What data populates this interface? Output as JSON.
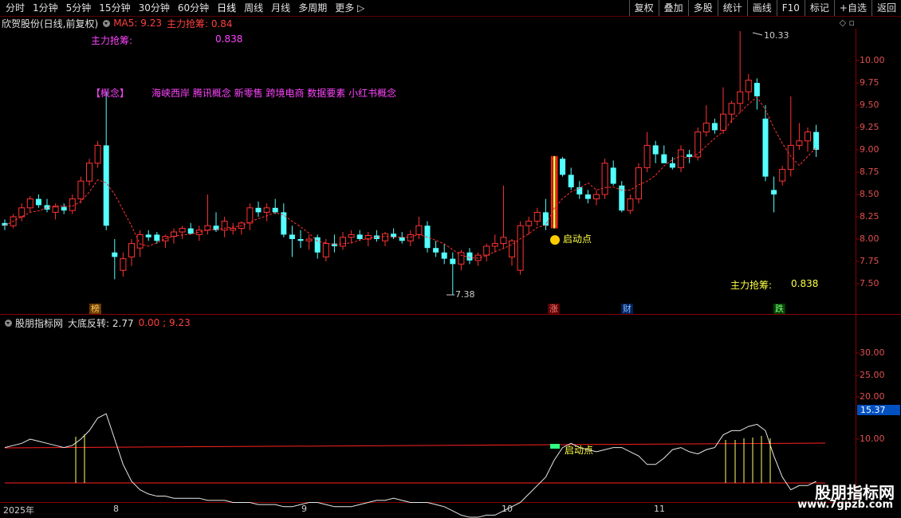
{
  "toolbar": {
    "periods": [
      "分时",
      "1分钟",
      "5分钟",
      "15分钟",
      "30分钟",
      "60分钟",
      "日线",
      "周线",
      "月线",
      "多周期",
      "更多"
    ],
    "buttons": [
      "复权",
      "叠加",
      "多股",
      "统计",
      "画线",
      "F10",
      "标记",
      "+自选",
      "返回"
    ]
  },
  "info": {
    "stock_name": "欣贺股份(日线,前复权)",
    "ma_label": "MA5: 9.23",
    "zl_label": "主力抢筹: 0.84"
  },
  "overlay": {
    "zl_title": "主力抢筹:",
    "zl_value": "0.838",
    "concept_label": "【概念】",
    "concepts": "海峡西岸 腾讯概念 新零售 跨境电商 数据要素 小红书概念",
    "qdd": "启动点",
    "zl_title2": "主力抢筹:",
    "zl_value2": "0.838",
    "high_price": "10.33",
    "low_price": "7.38"
  },
  "tags": {
    "bang": "榜",
    "zhang": "涨",
    "cai": "财",
    "die": "跌"
  },
  "sub": {
    "name": "股朋指标网",
    "name2": "大底反转: 2.77",
    "vals": "0.00 ; 9.23",
    "qdd": "启动点",
    "current": "15.37"
  },
  "axis": {
    "main": [
      "10.00",
      "9.75",
      "9.50",
      "9.25",
      "9.00",
      "8.75",
      "8.50",
      "8.25",
      "8.00",
      "7.75",
      "7.50"
    ],
    "sub": [
      "30.00",
      "25.00",
      "20.00",
      "10.00"
    ]
  },
  "dates": {
    "d0": "2025年",
    "d1": "8",
    "d2": "9",
    "d3": "10",
    "d4": "11"
  },
  "watermark": {
    "logo": "股朋指标网",
    "url": "www.7gpzb.com"
  },
  "colors": {
    "up": "#ff3232",
    "down": "#54ffff",
    "ma": "#ff3232",
    "zl": "#ff44ff",
    "yellow": "#ffff44"
  },
  "chart_data": {
    "type": "candlestick",
    "ohlc": [
      [
        8.18,
        8.22,
        8.1,
        8.15
      ],
      [
        8.15,
        8.28,
        8.12,
        8.25
      ],
      [
        8.25,
        8.4,
        8.2,
        8.35
      ],
      [
        8.35,
        8.48,
        8.3,
        8.45
      ],
      [
        8.45,
        8.5,
        8.35,
        8.38
      ],
      [
        8.38,
        8.45,
        8.3,
        8.33
      ],
      [
        8.3,
        8.4,
        8.22,
        8.36
      ],
      [
        8.36,
        8.4,
        8.28,
        8.32
      ],
      [
        8.32,
        8.5,
        8.28,
        8.45
      ],
      [
        8.45,
        8.7,
        8.4,
        8.65
      ],
      [
        8.65,
        8.9,
        8.6,
        8.85
      ],
      [
        8.85,
        9.1,
        8.8,
        9.05
      ],
      [
        9.05,
        9.65,
        8.1,
        8.15
      ],
      [
        7.85,
        8.0,
        7.55,
        7.8
      ],
      [
        7.65,
        7.85,
        7.58,
        7.78
      ],
      [
        7.8,
        8.0,
        7.7,
        7.95
      ],
      [
        7.9,
        8.1,
        7.8,
        8.05
      ],
      [
        8.05,
        8.1,
        7.98,
        8.02
      ],
      [
        8.05,
        8.08,
        7.95,
        7.98
      ],
      [
        7.98,
        8.05,
        7.9,
        8.03
      ],
      [
        8.03,
        8.12,
        7.95,
        8.08
      ],
      [
        8.08,
        8.15,
        8.0,
        8.12
      ],
      [
        8.12,
        8.18,
        8.05,
        8.06
      ],
      [
        8.05,
        8.15,
        7.98,
        8.1
      ],
      [
        8.1,
        8.5,
        8.05,
        8.15
      ],
      [
        8.15,
        8.3,
        8.08,
        8.1
      ],
      [
        8.1,
        8.25,
        8.02,
        8.2
      ],
      [
        8.1,
        8.18,
        8.05,
        8.12
      ],
      [
        8.12,
        8.2,
        8.05,
        8.18
      ],
      [
        8.18,
        8.4,
        8.1,
        8.35
      ],
      [
        8.35,
        8.42,
        8.25,
        8.3
      ],
      [
        8.3,
        8.4,
        8.2,
        8.35
      ],
      [
        8.35,
        8.45,
        8.28,
        8.3
      ],
      [
        8.3,
        8.4,
        8.02,
        8.05
      ],
      [
        8.05,
        8.15,
        7.8,
        8.0
      ],
      [
        8.0,
        8.1,
        7.9,
        7.98
      ],
      [
        7.98,
        8.05,
        7.88,
        8.0
      ],
      [
        8.02,
        8.05,
        7.78,
        7.85
      ],
      [
        7.8,
        8.0,
        7.75,
        7.95
      ],
      [
        7.95,
        8.05,
        7.85,
        7.92
      ],
      [
        7.92,
        8.08,
        7.88,
        8.02
      ],
      [
        8.02,
        8.1,
        7.95,
        8.05
      ],
      [
        8.05,
        8.1,
        7.98,
        8.0
      ],
      [
        8.0,
        8.08,
        7.92,
        8.04
      ],
      [
        8.04,
        8.1,
        7.97,
        8.0
      ],
      [
        7.98,
        8.08,
        7.92,
        8.06
      ],
      [
        8.06,
        8.12,
        8.0,
        8.02
      ],
      [
        8.02,
        8.08,
        7.95,
        7.98
      ],
      [
        7.98,
        8.1,
        7.92,
        8.05
      ],
      [
        8.05,
        8.25,
        8.0,
        8.15
      ],
      [
        8.15,
        8.2,
        7.85,
        7.9
      ],
      [
        7.9,
        7.98,
        7.8,
        7.85
      ],
      [
        7.85,
        7.95,
        7.72,
        7.78
      ],
      [
        7.78,
        7.85,
        7.38,
        7.72
      ],
      [
        7.72,
        7.88,
        7.65,
        7.85
      ],
      [
        7.85,
        7.9,
        7.72,
        7.76
      ],
      [
        7.76,
        7.85,
        7.7,
        7.82
      ],
      [
        7.82,
        7.95,
        7.75,
        7.92
      ],
      [
        7.92,
        8.05,
        7.85,
        7.95
      ],
      [
        7.95,
        8.6,
        7.9,
        8.02
      ],
      [
        7.8,
        8.0,
        7.7,
        7.98
      ],
      [
        7.65,
        8.2,
        7.6,
        8.15
      ],
      [
        8.15,
        8.25,
        8.05,
        8.2
      ],
      [
        8.2,
        8.35,
        8.15,
        8.3
      ],
      [
        8.3,
        8.45,
        8.1,
        8.15
      ],
      [
        8.15,
        8.93,
        8.12,
        8.9
      ],
      [
        8.9,
        8.92,
        8.7,
        8.72
      ],
      [
        8.72,
        8.8,
        8.55,
        8.58
      ],
      [
        8.58,
        8.65,
        8.45,
        8.5
      ],
      [
        8.5,
        8.55,
        8.4,
        8.45
      ],
      [
        8.45,
        8.55,
        8.38,
        8.5
      ],
      [
        8.5,
        8.9,
        8.45,
        8.85
      ],
      [
        8.8,
        8.88,
        8.6,
        8.62
      ],
      [
        8.6,
        8.65,
        8.3,
        8.32
      ],
      [
        8.32,
        8.5,
        8.28,
        8.45
      ],
      [
        8.45,
        8.85,
        8.4,
        8.8
      ],
      [
        8.8,
        9.2,
        8.75,
        9.05
      ],
      [
        9.05,
        9.1,
        8.85,
        8.95
      ],
      [
        8.95,
        9.05,
        8.85,
        8.85
      ],
      [
        8.85,
        8.92,
        8.78,
        8.8
      ],
      [
        8.8,
        9.05,
        8.75,
        9.0
      ],
      [
        8.95,
        9.0,
        8.85,
        8.92
      ],
      [
        8.92,
        9.25,
        8.88,
        9.2
      ],
      [
        9.2,
        9.5,
        9.15,
        9.3
      ],
      [
        9.3,
        9.35,
        9.18,
        9.22
      ],
      [
        9.22,
        9.7,
        9.18,
        9.4
      ],
      [
        9.4,
        9.55,
        9.3,
        9.52
      ],
      [
        9.52,
        10.33,
        9.42,
        9.65
      ],
      [
        9.65,
        9.85,
        9.55,
        9.78
      ],
      [
        9.75,
        9.8,
        9.45,
        9.6
      ],
      [
        9.35,
        9.5,
        8.65,
        8.7
      ],
      [
        8.55,
        8.7,
        8.3,
        8.5
      ],
      [
        8.65,
        8.82,
        8.6,
        8.78
      ],
      [
        8.78,
        9.6,
        8.7,
        9.05
      ],
      [
        9.05,
        9.3,
        9.0,
        9.1
      ],
      [
        9.1,
        9.25,
        8.98,
        9.2
      ],
      [
        9.2,
        9.28,
        8.92,
        9.0
      ]
    ]
  }
}
